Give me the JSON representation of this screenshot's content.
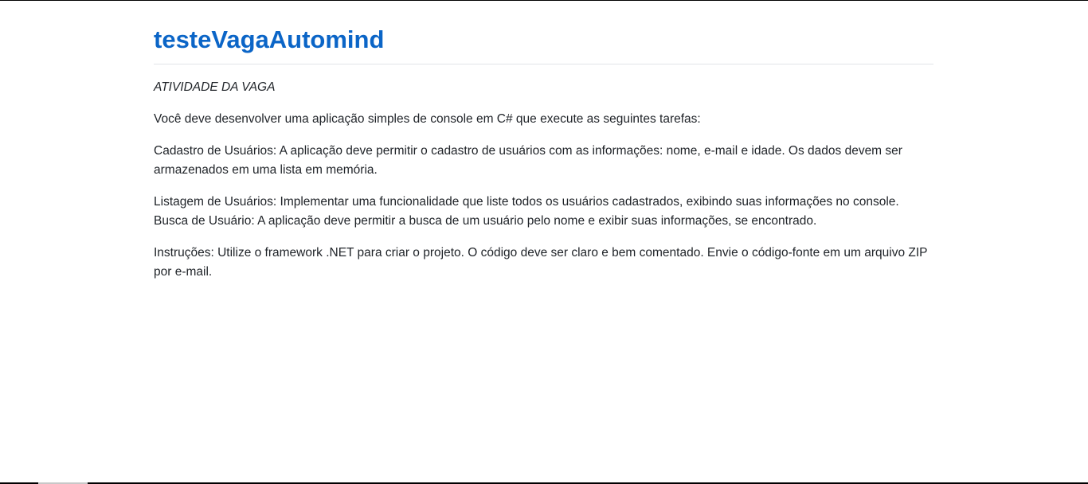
{
  "document": {
    "title": "testeVagaAutomind",
    "section_heading": "ATIVIDADE DA VAGA",
    "intro": "Você deve desenvolver uma aplicação simples de console em C# que execute as seguintes tarefas:",
    "cadastro": "Cadastro de Usuários: A aplicação deve permitir o cadastro de usuários com as informações: nome, e-mail e idade. Os dados devem ser armazenados em uma lista em memória.",
    "listagem": "Listagem de Usuários: Implementar uma funcionalidade que liste todos os usuários cadastrados, exibindo suas informações no console.",
    "busca": "Busca de Usuário: A aplicação deve permitir a busca de um usuário pelo nome e exibir suas informações, se encontrado.",
    "instrucoes": "Instruções: Utilize o framework .NET para criar o projeto. O código deve ser claro e bem comentado. Envie o código-fonte em um arquivo ZIP por e-mail."
  },
  "colors": {
    "title": "#0b65c7",
    "text": "#1f2328",
    "rule": "#e1e4e8"
  }
}
